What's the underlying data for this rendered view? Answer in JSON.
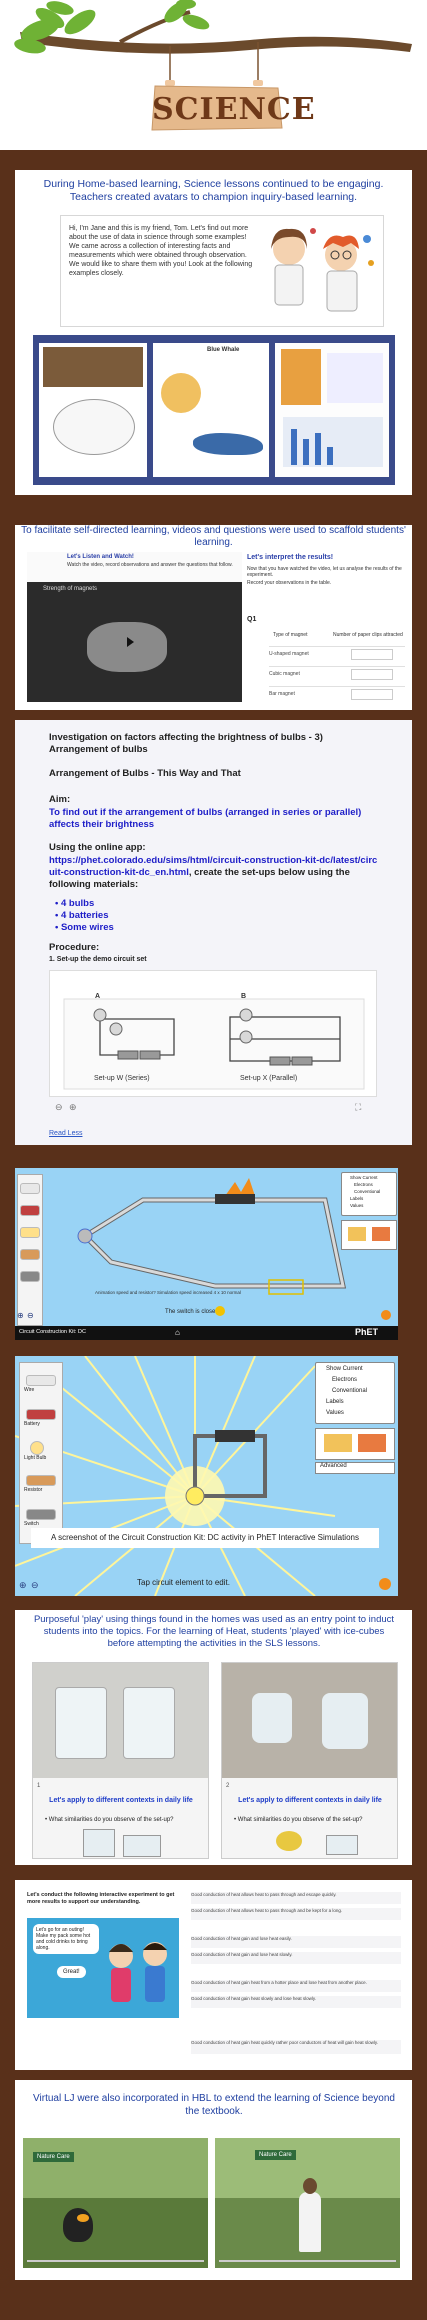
{
  "header": {
    "title": "SCIENCE",
    "colors": {
      "sign": "#e5b98c",
      "title": "#6e3818",
      "panel": "#59301a",
      "leaf": "#6fb235"
    }
  },
  "section1": {
    "caption": "During Home-based learning, Science lessons continued to be engaging. Teachers created avatars to champion inquiry-based learning.",
    "speech": "Hi, I'm Jane and this is my friend, Tom. Let's find out more about the use of data in science through some examples! We came across a collection of interesting facts and measurements which were obtained through observation. We would like to share them with you! Look at the following examples closely.",
    "thumb2_title": "Blue Whale"
  },
  "section2": {
    "caption": "To facilitate self-directed learning, videos and questions were used to scaffold students' learning.",
    "left_title": "Let's Listen and Watch!",
    "video_title": "Strength of magnets",
    "right_title": "Let's interpret the results!",
    "q_label": "Q1",
    "table_head": [
      "Type of magnet",
      "Number of paper clips attracted"
    ],
    "table_rows": [
      "U-shaped magnet",
      "Cubic magnet",
      "Bar magnet"
    ]
  },
  "section3": {
    "heading": "Investigation on factors affecting the brightness of bulbs - 3) Arrangement of bulbs",
    "sub": "Arrangement of Bulbs - This Way and That",
    "aim_label": "Aim:",
    "aim": "To find out if the arrangement of bulbs (arranged in series or parallel) affects their brightness",
    "using_label": "Using the online app:",
    "url": "https://phet.colorado.edu/sims/html/circuit-construction-kit-dc/latest/circuit-construction-kit-dc_en.html",
    "using_suffix": ", create the set-ups below using the following materials:",
    "materials": [
      "4 bulbs",
      "4 batteries",
      "Some wires"
    ],
    "procedure_label": "Procedure:",
    "step1": "1. Set-up the demo circuit set",
    "setup_a_letter": "A",
    "setup_b_letter": "B",
    "setup_a": "Set-up W (Series)",
    "setup_b": "Set-up X (Parallel)",
    "read_less": "Read Less"
  },
  "sim1": {
    "note": "Animation speed and resistor? Simulation speed increased 4 x 10 normal",
    "switch_text": "The switch is closed.",
    "footer_left": "Circuit Construction Kit: DC",
    "footer_brand": "PhET",
    "panel_items": [
      "Show Current",
      "Electrons",
      "Conventional",
      "Labels",
      "Values"
    ]
  },
  "sim2": {
    "left_items": [
      "Wire",
      "Battery",
      "Light Bulb",
      "Resistor",
      "Switch"
    ],
    "right_items": [
      "Show Current",
      "Electrons",
      "Conventional",
      "Labels",
      "Values"
    ],
    "advanced": "Advanced",
    "caption": "A screenshot of the Circuit Construction Kit: DC activity in PhET Interactive Simulations",
    "tap_text": "Tap circuit element to edit."
  },
  "section4": {
    "caption": "Purposeful 'play' using things found in the homes was used as an entry point to induct students into the topics. For the learning of Heat, students 'played' with ice-cubes before attempting the activities in the SLS lessons.",
    "photo1_num": "1",
    "photo2_num": "2",
    "label1": "Let's apply to different contexts in daily life",
    "q1": "What similarities do you observe of the set-up?",
    "label2": "Let's apply to different contexts in daily life",
    "q2": "What similarities do you observe of the set-up?"
  },
  "section5": {
    "intro": "Let's conduct the following interactive experiment to get more results to support our understanding.",
    "bubble1": "Let's go for an outing! Make my pack some hot and cold drinks to bring along.",
    "bubble2": "Great!",
    "options": [
      "Good conduction of heat allows heat to pass through and escape quickly.",
      "Good conduction of heat allows heat to pass through and be kept for a long.",
      "Good conduction of heat gain and lose heat easily.",
      "Good conduction of heat gain and lose heat slowly.",
      "Good conduction of heat gain heat from a hotter place and lose heat from another place.",
      "Good conduction of heat gain heat slowly and lose heat slowly.",
      "Good conduction of heat gain heat quickly rather poor conductors of heat will gain heat slowly."
    ]
  },
  "section6": {
    "caption": "Virtual LJ were also incorporated in HBL to extend the learning of Science beyond the textbook.",
    "sign1": "Nature Care",
    "sign2": "Nature Care"
  }
}
